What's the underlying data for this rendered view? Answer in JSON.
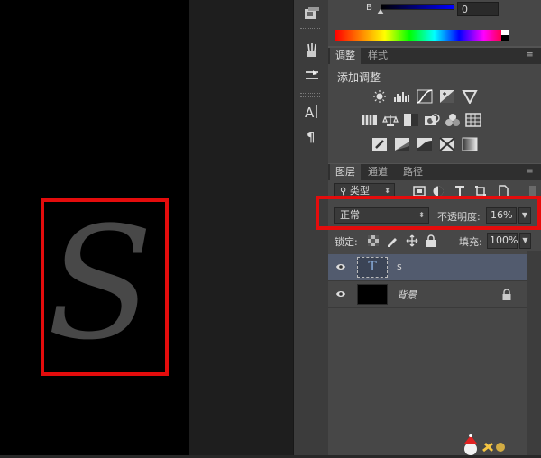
{
  "canvas": {
    "letter": "S"
  },
  "color_panel": {
    "channel_label": "B",
    "channel_value": "0",
    "channel_level": 0
  },
  "adjustments_panel": {
    "tabs": [
      "调整",
      "样式"
    ],
    "heading": "添加调整",
    "icons_row1": [
      "brightness-contrast-icon",
      "levels-icon",
      "curves-icon",
      "exposure-icon",
      "vibrance-icon"
    ],
    "icons_row2": [
      "hue-saturation-icon",
      "color-balance-icon",
      "black-white-icon",
      "photo-filter-icon",
      "channel-mixer-icon",
      "color-lookup-icon"
    ],
    "icons_row3": [
      "invert-icon",
      "posterize-icon",
      "threshold-icon",
      "selective-color-icon",
      "gradient-map-icon"
    ]
  },
  "layers_panel": {
    "tabs": [
      "图层",
      "通道",
      "路径"
    ],
    "filter_label": "类型",
    "blend_mode": "正常",
    "opacity_label": "不透明度:",
    "opacity_value": "16%",
    "lock_label": "锁定:",
    "fill_label": "填充:",
    "fill_value": "100%",
    "layers": [
      {
        "name": "s",
        "thumb": "T",
        "visible": true,
        "selected": true
      },
      {
        "name": "背景",
        "visible": true,
        "locked": true
      }
    ]
  },
  "colors": {
    "highlight_red": "#e40c0c",
    "selected_layer": "#525b6e",
    "text_thumb_glyph": "#8fb3e3"
  }
}
